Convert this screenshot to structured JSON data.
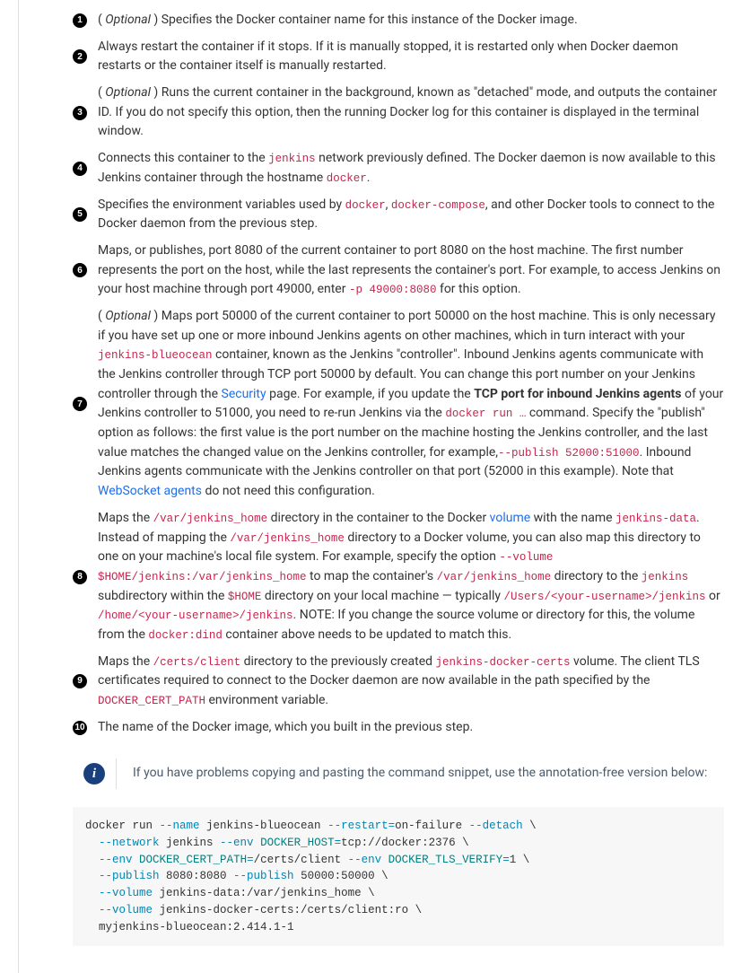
{
  "callouts": [
    {
      "n": "1",
      "parts": [
        {
          "t": "text",
          "v": "( "
        },
        {
          "t": "em",
          "v": "Optional"
        },
        {
          "t": "text",
          "v": " ) Specifies the Docker container name for this instance of the Docker image."
        }
      ]
    },
    {
      "n": "2",
      "tall": true,
      "parts": [
        {
          "t": "text",
          "v": "Always restart the container if it stops. If it is manually stopped, it is restarted only when Docker daemon restarts or the container itself is manually restarted."
        }
      ]
    },
    {
      "n": "3",
      "tall": true,
      "parts": [
        {
          "t": "text",
          "v": "( "
        },
        {
          "t": "em",
          "v": "Optional"
        },
        {
          "t": "text",
          "v": " ) Runs the current container in the background, known as \"detached\" mode, and outputs the container ID. If you do not specify this option, then the running Docker log for this container is displayed in the terminal window."
        }
      ]
    },
    {
      "n": "4",
      "tall": true,
      "parts": [
        {
          "t": "text",
          "v": "Connects this container to the "
        },
        {
          "t": "code",
          "v": "jenkins"
        },
        {
          "t": "text",
          "v": " network previously defined. The Docker daemon is now available to this Jenkins container through the hostname "
        },
        {
          "t": "code",
          "v": "docker"
        },
        {
          "t": "text",
          "v": "."
        }
      ]
    },
    {
      "n": "5",
      "tall": true,
      "parts": [
        {
          "t": "text",
          "v": "Specifies the environment variables used by "
        },
        {
          "t": "code",
          "v": "docker"
        },
        {
          "t": "text",
          "v": ", "
        },
        {
          "t": "code",
          "v": "docker-compose"
        },
        {
          "t": "text",
          "v": ", and other Docker tools to connect to the Docker daemon from the previous step."
        }
      ]
    },
    {
      "n": "6",
      "tall": true,
      "parts": [
        {
          "t": "text",
          "v": "Maps, or publishes, port 8080 of the current container to port 8080 on the host machine. The first number represents the port on the host, while the last represents the container's port. For example, to access Jenkins on your host machine through port 49000, enter "
        },
        {
          "t": "code",
          "v": "-p 49000:8080"
        },
        {
          "t": "text",
          "v": " for this option."
        }
      ]
    },
    {
      "n": "7",
      "tall": true,
      "parts": [
        {
          "t": "text",
          "v": "( "
        },
        {
          "t": "em",
          "v": "Optional"
        },
        {
          "t": "text",
          "v": " ) Maps port 50000 of the current container to port 50000 on the host machine. This is only necessary if you have set up one or more inbound Jenkins agents on other machines, which in turn interact with your "
        },
        {
          "t": "code",
          "v": "jenkins-blueocean"
        },
        {
          "t": "text",
          "v": " container, known as the Jenkins \"controller\". Inbound Jenkins agents communicate with the Jenkins controller through TCP port 50000 by default. You can change this port number on your Jenkins controller through the "
        },
        {
          "t": "link",
          "v": "Security"
        },
        {
          "t": "text",
          "v": " page. For example, if you update the "
        },
        {
          "t": "strong",
          "v": "TCP port for inbound Jenkins agents"
        },
        {
          "t": "text",
          "v": " of your Jenkins controller to 51000, you need to re-run Jenkins via the "
        },
        {
          "t": "code",
          "v": "docker run …"
        },
        {
          "t": "text",
          "v": " command. Specify the \"publish\" option as follows: the first value is the port number on the machine hosting the Jenkins controller, and the last value matches the changed value on the Jenkins controller, for example,"
        },
        {
          "t": "code",
          "v": "--publish 52000:51000"
        },
        {
          "t": "text",
          "v": ". Inbound Jenkins agents communicate with the Jenkins controller on that port (52000 in this example). Note that "
        },
        {
          "t": "link",
          "v": "WebSocket agents"
        },
        {
          "t": "text",
          "v": " do not need this configuration."
        }
      ]
    },
    {
      "n": "8",
      "tall": true,
      "parts": [
        {
          "t": "text",
          "v": "Maps the "
        },
        {
          "t": "code",
          "v": "/var/jenkins_home"
        },
        {
          "t": "text",
          "v": " directory in the container to the Docker "
        },
        {
          "t": "link",
          "v": "volume"
        },
        {
          "t": "text",
          "v": " with the name "
        },
        {
          "t": "code",
          "v": "jenkins-data"
        },
        {
          "t": "text",
          "v": ". Instead of mapping the "
        },
        {
          "t": "code",
          "v": "/var/jenkins_home"
        },
        {
          "t": "text",
          "v": " directory to a Docker volume, you can also map this directory to one on your machine's local file system. For example, specify the option "
        },
        {
          "t": "code",
          "v": "--volume $HOME/jenkins:/var/jenkins_home"
        },
        {
          "t": "text",
          "v": " to map the container's "
        },
        {
          "t": "code",
          "v": "/var/jenkins_home"
        },
        {
          "t": "text",
          "v": " directory to the "
        },
        {
          "t": "code",
          "v": "jenkins"
        },
        {
          "t": "text",
          "v": " subdirectory within the "
        },
        {
          "t": "code",
          "v": "$HOME"
        },
        {
          "t": "text",
          "v": " directory on your local machine — typically "
        },
        {
          "t": "code",
          "v": "/Users/<your-username>/jenkins"
        },
        {
          "t": "text",
          "v": " or "
        },
        {
          "t": "code",
          "v": "/home/<your-username>/jenkins"
        },
        {
          "t": "text",
          "v": ". NOTE: If you change the source volume or directory for this, the volume from the "
        },
        {
          "t": "code",
          "v": "docker:dind"
        },
        {
          "t": "text",
          "v": " container above needs to be updated to match this."
        }
      ]
    },
    {
      "n": "9",
      "tall": true,
      "parts": [
        {
          "t": "text",
          "v": "Maps the "
        },
        {
          "t": "code",
          "v": "/certs/client"
        },
        {
          "t": "text",
          "v": " directory to the previously created "
        },
        {
          "t": "code",
          "v": "jenkins-docker-certs"
        },
        {
          "t": "text",
          "v": " volume. The client TLS certificates required to connect to the Docker daemon are now available in the path specified by the "
        },
        {
          "t": "code",
          "v": "DOCKER_CERT_PATH"
        },
        {
          "t": "text",
          "v": " environment variable."
        }
      ]
    },
    {
      "n": "10",
      "parts": [
        {
          "t": "text",
          "v": "The name of the Docker image, which you built in the previous step."
        }
      ]
    }
  ],
  "admonition": {
    "icon_letter": "i",
    "text": "If you have problems copying and pasting the command snippet, use the annotation-free version below:"
  },
  "code": {
    "lines": [
      [
        {
          "c": "cmd",
          "v": "docker run "
        },
        {
          "c": "flag",
          "v": "--name"
        },
        {
          "c": "cmd",
          "v": " jenkins-blueocean "
        },
        {
          "c": "flag",
          "v": "--restart"
        },
        {
          "c": "flag",
          "v": "="
        },
        {
          "c": "cmd",
          "v": "on-failure "
        },
        {
          "c": "flag",
          "v": "--detach"
        },
        {
          "c": "cmd",
          "v": " "
        },
        {
          "c": "cont",
          "v": "\\"
        }
      ],
      [
        {
          "c": "cmd",
          "v": "  "
        },
        {
          "c": "flag",
          "v": "--network"
        },
        {
          "c": "cmd",
          "v": " jenkins "
        },
        {
          "c": "flag",
          "v": "--env"
        },
        {
          "c": "cmd",
          "v": " "
        },
        {
          "c": "var",
          "v": "DOCKER_HOST"
        },
        {
          "c": "flag",
          "v": "="
        },
        {
          "c": "cmd",
          "v": "tcp://docker:2376 "
        },
        {
          "c": "cont",
          "v": "\\"
        }
      ],
      [
        {
          "c": "cmd",
          "v": "  "
        },
        {
          "c": "flag",
          "v": "--env"
        },
        {
          "c": "cmd",
          "v": " "
        },
        {
          "c": "var",
          "v": "DOCKER_CERT_PATH"
        },
        {
          "c": "flag",
          "v": "="
        },
        {
          "c": "cmd",
          "v": "/certs/client "
        },
        {
          "c": "flag",
          "v": "--env"
        },
        {
          "c": "cmd",
          "v": " "
        },
        {
          "c": "var",
          "v": "DOCKER_TLS_VERIFY"
        },
        {
          "c": "flag",
          "v": "="
        },
        {
          "c": "cmd",
          "v": "1 "
        },
        {
          "c": "cont",
          "v": "\\"
        }
      ],
      [
        {
          "c": "cmd",
          "v": "  "
        },
        {
          "c": "flag",
          "v": "--publish"
        },
        {
          "c": "cmd",
          "v": " 8080:8080 "
        },
        {
          "c": "flag",
          "v": "--publish"
        },
        {
          "c": "cmd",
          "v": " 50000:50000 "
        },
        {
          "c": "cont",
          "v": "\\"
        }
      ],
      [
        {
          "c": "cmd",
          "v": "  "
        },
        {
          "c": "flag",
          "v": "--volume"
        },
        {
          "c": "cmd",
          "v": " jenkins-data:/var/jenkins_home "
        },
        {
          "c": "cont",
          "v": "\\"
        }
      ],
      [
        {
          "c": "cmd",
          "v": "  "
        },
        {
          "c": "flag",
          "v": "--volume"
        },
        {
          "c": "cmd",
          "v": " jenkins-docker-certs:/certs/client:ro "
        },
        {
          "c": "cont",
          "v": "\\"
        }
      ],
      [
        {
          "c": "cmd",
          "v": "  myjenkins-blueocean:2.414.1-1"
        }
      ]
    ]
  }
}
